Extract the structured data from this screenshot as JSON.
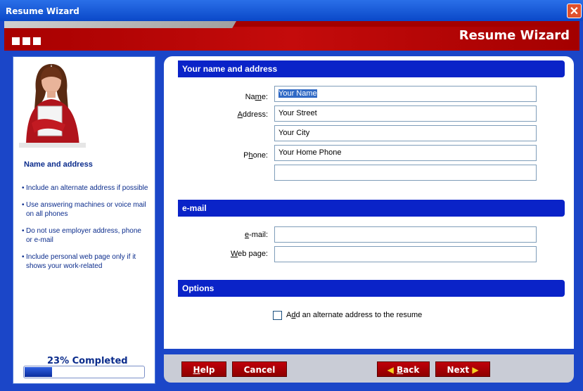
{
  "window": {
    "title": "Resume Wizard",
    "close_glyph": "✕"
  },
  "banner": {
    "title": "Resume Wizard"
  },
  "sidebar": {
    "heading": "Name and address",
    "tips": [
      "Include an alternate address if possible",
      "Use answering machines or voice mail on all phones",
      "Do not use employer address, phone or e-mail",
      "Include personal web page only if it shows your work-related"
    ],
    "progress": {
      "label": "23% Completed",
      "value": 0.23
    }
  },
  "sections": {
    "name_address": "Your name and address",
    "email": "e-mail",
    "options": "Options"
  },
  "fields": {
    "name": {
      "label_pre": "Na",
      "label_accel": "m",
      "label_post": "e:",
      "value": "Your Name"
    },
    "address": {
      "label_pre": "",
      "label_accel": "A",
      "label_post": "ddress:",
      "line1": "Your Street",
      "line2": "Your City"
    },
    "phone": {
      "label_pre": "P",
      "label_accel": "h",
      "label_post": "one:",
      "line1": "Your Home Phone",
      "line2": ""
    },
    "email": {
      "label_pre": "",
      "label_accel": "e",
      "label_post": "-mail:",
      "value": ""
    },
    "webpage": {
      "label_pre": "",
      "label_accel": "W",
      "label_post": "eb page:",
      "value": ""
    }
  },
  "options": {
    "alternate_address": {
      "label_pre": "A",
      "label_accel": "d",
      "label_post": "d an alternate address to the resume",
      "checked": false
    }
  },
  "buttons": {
    "help": {
      "accel": "H",
      "rest": "elp"
    },
    "cancel": "Cancel",
    "back": {
      "accel": "B",
      "rest": "ack",
      "arrow": "◀"
    },
    "next": "Next",
    "next_arrow": "▶"
  },
  "colors": {
    "accent": "#0a23c8",
    "banner": "#a40000",
    "window": "#1b46c8"
  }
}
